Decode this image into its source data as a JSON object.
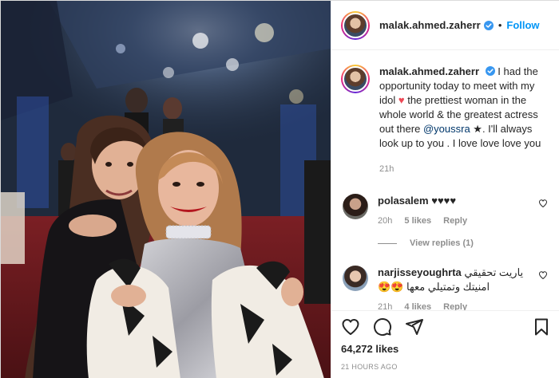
{
  "post": {
    "username": "malak.ahmed.zaherr",
    "verified": true,
    "follow_label": "Follow",
    "dot": "•"
  },
  "caption": {
    "username": "malak.ahmed.zaherr",
    "text_1": "I had the opportunity today to meet with my idol",
    "heart": "♥",
    "text_2": "the prettiest woman in the whole world & the greatest actress out there",
    "mention": "@youssra",
    "text_3": "★. I'll always look up to you . I love love love you",
    "time": "21h"
  },
  "comments": [
    {
      "username": "polasalem",
      "text": "♥♥♥♥",
      "time": "20h",
      "likes": "5 likes",
      "reply": "Reply",
      "view_replies": "View replies (1)",
      "icon": "heart-outline-icon"
    },
    {
      "username": "narjisseyoughrta",
      "text": "ياريت تحقيقي امنيتك وتمتيلي معها 😍😍",
      "time": "21h",
      "likes": "4 likes",
      "reply": "Reply",
      "icon": "heart-outline-icon"
    }
  ],
  "actions": {
    "icons": [
      "heart-outline-icon",
      "comment-icon",
      "share-icon",
      "bookmark-icon"
    ]
  },
  "likes_count": "64,272 likes",
  "posted_ago": "21 HOURS AGO",
  "colors": {
    "link": "#0095f6",
    "mention": "#00376b",
    "muted": "#8e8e8e",
    "heart": "#ed4956"
  }
}
